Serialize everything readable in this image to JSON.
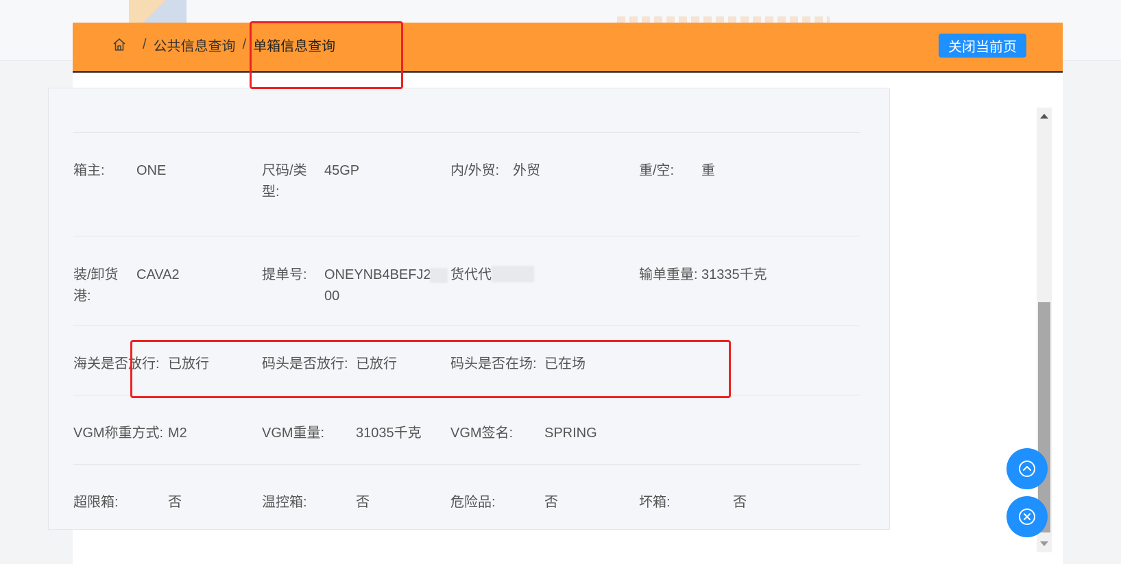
{
  "breadcrumb": {
    "items": [
      "公共信息查询",
      "单箱信息查询"
    ],
    "separator": "/"
  },
  "header": {
    "close_label": "关闭当前页"
  },
  "rows": [
    [
      {
        "label": "箱主:",
        "value": "ONE"
      },
      {
        "label": "尺码/类型:",
        "value": "45GP"
      },
      {
        "label": "内/外贸:",
        "value": "外贸"
      },
      {
        "label": "重/空:",
        "value": "重"
      }
    ],
    [
      {
        "label": "装/卸货港:",
        "value": "CAVA2"
      },
      {
        "label": "提单号:",
        "value": "ONEYNB4BEFJ2"
      },
      {
        "label": "货代代",
        "value": ""
      },
      {
        "label": "输单重量:",
        "value": "31335千克"
      }
    ],
    [
      {
        "label": "海关是否放行:",
        "value": "已放行"
      },
      {
        "label": "码头是否放行:",
        "value": "已放行"
      },
      {
        "label": "码头是否在场:",
        "value": "已在场"
      }
    ],
    [
      {
        "label": "VGM称重方式:",
        "value": "M2"
      },
      {
        "label": "VGM重量:",
        "value": "31035千克"
      },
      {
        "label": "VGM签名:",
        "value": "SPRING"
      }
    ],
    [
      {
        "label": "超限箱:",
        "value": "否"
      },
      {
        "label": "温控箱:",
        "value": "否"
      },
      {
        "label": "危险品:",
        "value": "否"
      },
      {
        "label": "坏箱:",
        "value": "否"
      }
    ]
  ],
  "bill_suffix": "00",
  "colors": {
    "header_bg": "#ff9933",
    "primary": "#1e90ff",
    "highlight": "#ee2222"
  },
  "icons": [
    "home-icon",
    "scroll-top-icon",
    "close-circle-icon"
  ]
}
